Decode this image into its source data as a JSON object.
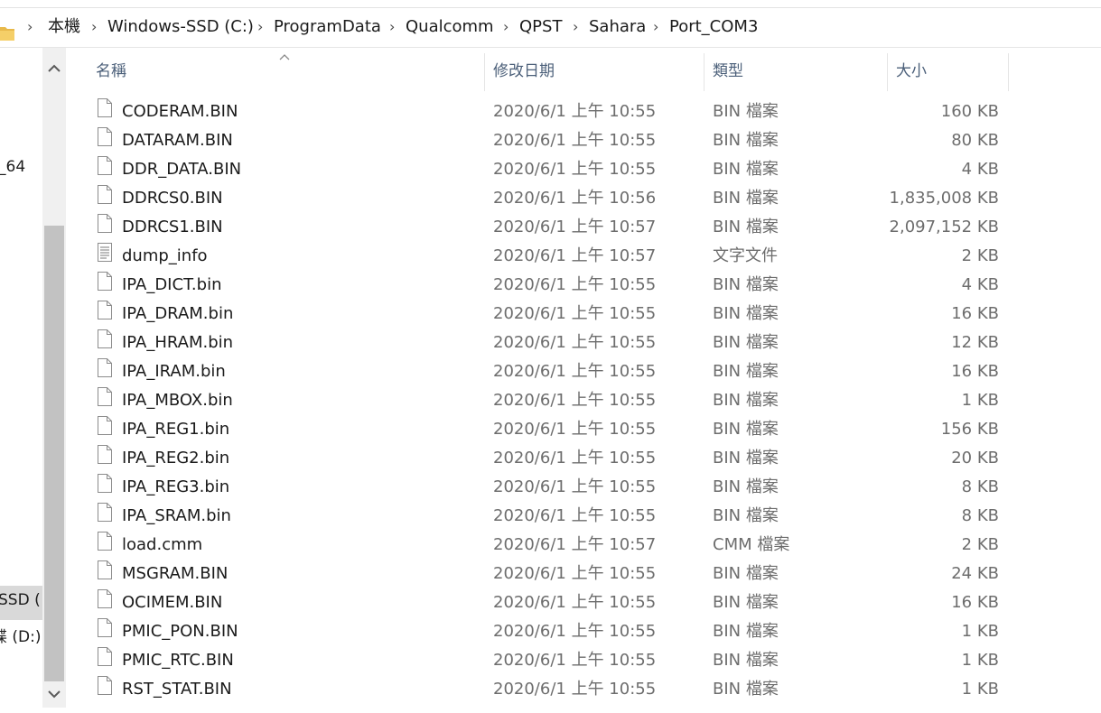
{
  "breadcrumb": [
    "本機",
    "Windows-SSD (C:)",
    "ProgramData",
    "Qualcomm",
    "QPST",
    "Sahara",
    "Port_COM3"
  ],
  "nav_pane": {
    "item_64": "_64",
    "item_ssd": "SSD (",
    "item_d": "碟 (D:)"
  },
  "columns": {
    "name": "名稱",
    "date": "修改日期",
    "type": "類型",
    "size": "大小"
  },
  "files": [
    {
      "name": "CODERAM.BIN",
      "date": "2020/6/1 上午 10:55",
      "type": "BIN 檔案",
      "size": "160 KB",
      "icon": "file-icon"
    },
    {
      "name": "DATARAM.BIN",
      "date": "2020/6/1 上午 10:55",
      "type": "BIN 檔案",
      "size": "80 KB",
      "icon": "file-icon"
    },
    {
      "name": "DDR_DATA.BIN",
      "date": "2020/6/1 上午 10:55",
      "type": "BIN 檔案",
      "size": "4 KB",
      "icon": "file-icon"
    },
    {
      "name": "DDRCS0.BIN",
      "date": "2020/6/1 上午 10:56",
      "type": "BIN 檔案",
      "size": "1,835,008 KB",
      "icon": "file-icon"
    },
    {
      "name": "DDRCS1.BIN",
      "date": "2020/6/1 上午 10:57",
      "type": "BIN 檔案",
      "size": "2,097,152 KB",
      "icon": "file-icon"
    },
    {
      "name": "dump_info",
      "date": "2020/6/1 上午 10:57",
      "type": "文字文件",
      "size": "2 KB",
      "icon": "text-file-icon"
    },
    {
      "name": "IPA_DICT.bin",
      "date": "2020/6/1 上午 10:55",
      "type": "BIN 檔案",
      "size": "4 KB",
      "icon": "file-icon"
    },
    {
      "name": "IPA_DRAM.bin",
      "date": "2020/6/1 上午 10:55",
      "type": "BIN 檔案",
      "size": "16 KB",
      "icon": "file-icon"
    },
    {
      "name": "IPA_HRAM.bin",
      "date": "2020/6/1 上午 10:55",
      "type": "BIN 檔案",
      "size": "12 KB",
      "icon": "file-icon"
    },
    {
      "name": "IPA_IRAM.bin",
      "date": "2020/6/1 上午 10:55",
      "type": "BIN 檔案",
      "size": "16 KB",
      "icon": "file-icon"
    },
    {
      "name": "IPA_MBOX.bin",
      "date": "2020/6/1 上午 10:55",
      "type": "BIN 檔案",
      "size": "1 KB",
      "icon": "file-icon"
    },
    {
      "name": "IPA_REG1.bin",
      "date": "2020/6/1 上午 10:55",
      "type": "BIN 檔案",
      "size": "156 KB",
      "icon": "file-icon"
    },
    {
      "name": "IPA_REG2.bin",
      "date": "2020/6/1 上午 10:55",
      "type": "BIN 檔案",
      "size": "20 KB",
      "icon": "file-icon"
    },
    {
      "name": "IPA_REG3.bin",
      "date": "2020/6/1 上午 10:55",
      "type": "BIN 檔案",
      "size": "8 KB",
      "icon": "file-icon"
    },
    {
      "name": "IPA_SRAM.bin",
      "date": "2020/6/1 上午 10:55",
      "type": "BIN 檔案",
      "size": "8 KB",
      "icon": "file-icon"
    },
    {
      "name": "load.cmm",
      "date": "2020/6/1 上午 10:57",
      "type": "CMM 檔案",
      "size": "2 KB",
      "icon": "file-icon"
    },
    {
      "name": "MSGRAM.BIN",
      "date": "2020/6/1 上午 10:55",
      "type": "BIN 檔案",
      "size": "24 KB",
      "icon": "file-icon"
    },
    {
      "name": "OCIMEM.BIN",
      "date": "2020/6/1 上午 10:55",
      "type": "BIN 檔案",
      "size": "16 KB",
      "icon": "file-icon"
    },
    {
      "name": "PMIC_PON.BIN",
      "date": "2020/6/1 上午 10:55",
      "type": "BIN 檔案",
      "size": "1 KB",
      "icon": "file-icon"
    },
    {
      "name": "PMIC_RTC.BIN",
      "date": "2020/6/1 上午 10:55",
      "type": "BIN 檔案",
      "size": "1 KB",
      "icon": "file-icon"
    },
    {
      "name": "RST_STAT.BIN",
      "date": "2020/6/1 上午 10:55",
      "type": "BIN 檔案",
      "size": "1 KB",
      "icon": "file-icon"
    }
  ],
  "colors": {
    "header_text": "#4c607a",
    "secondary_text": "#6d6d6d",
    "folder_icon": "#e8b94a",
    "scrollbar_thumb": "#c2c2c2",
    "selection": "#d9d9d9"
  }
}
